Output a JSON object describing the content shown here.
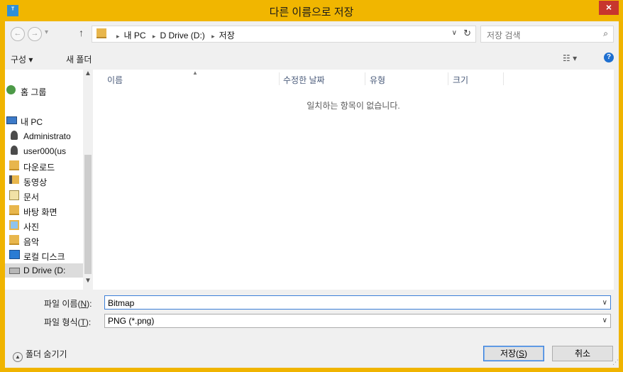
{
  "window": {
    "title": "다른 이름으로 저장",
    "close_glyph": "×"
  },
  "navigation": {
    "back_glyph": "←",
    "forward_glyph": "→",
    "recent_glyph": "▾",
    "up_glyph": "↑",
    "breadcrumb": [
      "내 PC",
      "D Drive (D:)",
      "저장"
    ],
    "crumb_sep": "▸",
    "dropdown_glyph": "∨",
    "refresh_glyph": "↻"
  },
  "search": {
    "placeholder": "저장 검색"
  },
  "toolbar": {
    "organize_label": "구성 ▾",
    "new_folder_label": "새 폴더",
    "view_glyph": "☷ ▾",
    "help_glyph": "?"
  },
  "sidebar": {
    "items": [
      {
        "label": "홈 그룹",
        "icon": "homegroup-icon"
      },
      {
        "label": "내 PC",
        "icon": "computer-icon"
      },
      {
        "label": "Administrato",
        "icon": "user-icon"
      },
      {
        "label": "user000(us",
        "icon": "user-icon"
      },
      {
        "label": "다운로드",
        "icon": "downloads-folder-icon"
      },
      {
        "label": "동영상",
        "icon": "videos-folder-icon"
      },
      {
        "label": "문서",
        "icon": "documents-folder-icon"
      },
      {
        "label": "바탕 화면",
        "icon": "desktop-folder-icon"
      },
      {
        "label": "사진",
        "icon": "pictures-folder-icon"
      },
      {
        "label": "음악",
        "icon": "music-folder-icon"
      },
      {
        "label": "로컬 디스크",
        "icon": "local-disk-icon"
      },
      {
        "label": "D Drive (D:",
        "icon": "drive-icon",
        "selected": true
      }
    ],
    "scroll_up_glyph": "▲",
    "scroll_down_glyph": "▼"
  },
  "file_list": {
    "columns": [
      "이름",
      "수정한 날짜",
      "유형",
      "크기"
    ],
    "sort_glyph": "▲",
    "empty_message": "일치하는 항목이 없습니다."
  },
  "form": {
    "filename_label_pre": "파일 이름(",
    "filename_label_key": "N",
    "filename_label_post": "):",
    "filename_value": "Bitmap",
    "filetype_label_pre": "파일 형식(",
    "filetype_label_key": "T",
    "filetype_label_post": "):",
    "filetype_value": "PNG (*.png)",
    "dropdown_glyph": "∨"
  },
  "footer": {
    "hide_folders_label": "폴더 숨기기",
    "hide_glyph": "▲",
    "save_pre": "저장(",
    "save_key": "S",
    "save_post": ")",
    "cancel_label": "취소",
    "grip_glyph": "⋰"
  }
}
